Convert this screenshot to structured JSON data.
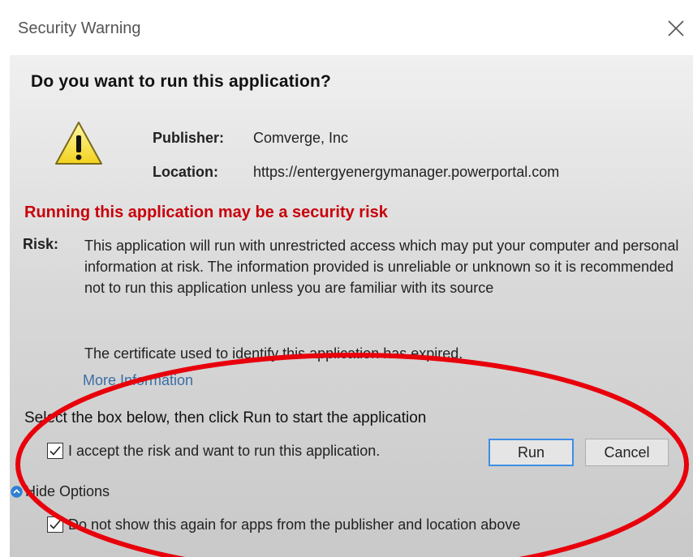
{
  "window": {
    "title": "Security Warning"
  },
  "dialog": {
    "heading": "Do you want to run this application?",
    "publisher_label": "Publisher:",
    "publisher_value": "Comverge, Inc",
    "location_label": "Location:",
    "location_value": "https://entergyenergymanager.powerportal.com",
    "risk_heading": "Running this application may be a security risk",
    "risk_label": "Risk:",
    "risk_text": "This application will run with unrestricted access which may put your computer and personal information at risk. The information provided is unreliable or unknown so it is recommended not to run this application unless you are familiar with its source",
    "cert_text": "The certificate used to identify this application has expired.",
    "more_info": "More Information",
    "select_text": "Select the box below, then click Run to start the application",
    "accept_label": "I accept the risk and want to run this application.",
    "accept_checked": true,
    "run_label": "Run",
    "cancel_label": "Cancel",
    "hide_options": "Hide Options",
    "dont_show_label": "Do not show this again for apps from the publisher and location above",
    "dont_show_checked": true
  },
  "icons": {
    "close": "close-icon",
    "warning": "warning-icon",
    "hide_options": "chevron-up-icon",
    "checkmark": "checkmark-icon"
  },
  "colors": {
    "risk_heading": "#c8000a",
    "link": "#3a6ea5",
    "run_border": "#3c8ee6",
    "annotation": "#e8000b"
  }
}
